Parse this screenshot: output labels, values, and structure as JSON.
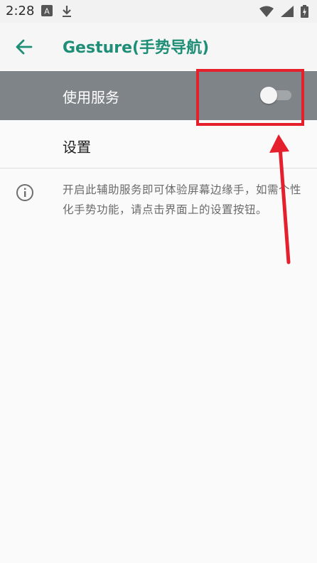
{
  "status_bar": {
    "time": "2:28",
    "icons": [
      "font-a-icon",
      "download-icon",
      "wifi-icon",
      "signal-icon",
      "battery-charging-icon"
    ]
  },
  "app_bar": {
    "title": "Gesture(手势导航)",
    "back_icon": "arrow-left-icon"
  },
  "service_row": {
    "label": "使用服务",
    "toggle_on": false
  },
  "settings_row": {
    "label": "设置"
  },
  "info": {
    "icon": "info-icon",
    "text": "开启此辅助服务即可体验屏幕边缘手，如需个性化手势功能，请点击界面上的设置按钮。"
  },
  "annotation": {
    "color": "#e5202c"
  },
  "colors": {
    "accent": "#1e8e76",
    "selected_row": "#7f8488",
    "annotation": "#e5202c"
  }
}
